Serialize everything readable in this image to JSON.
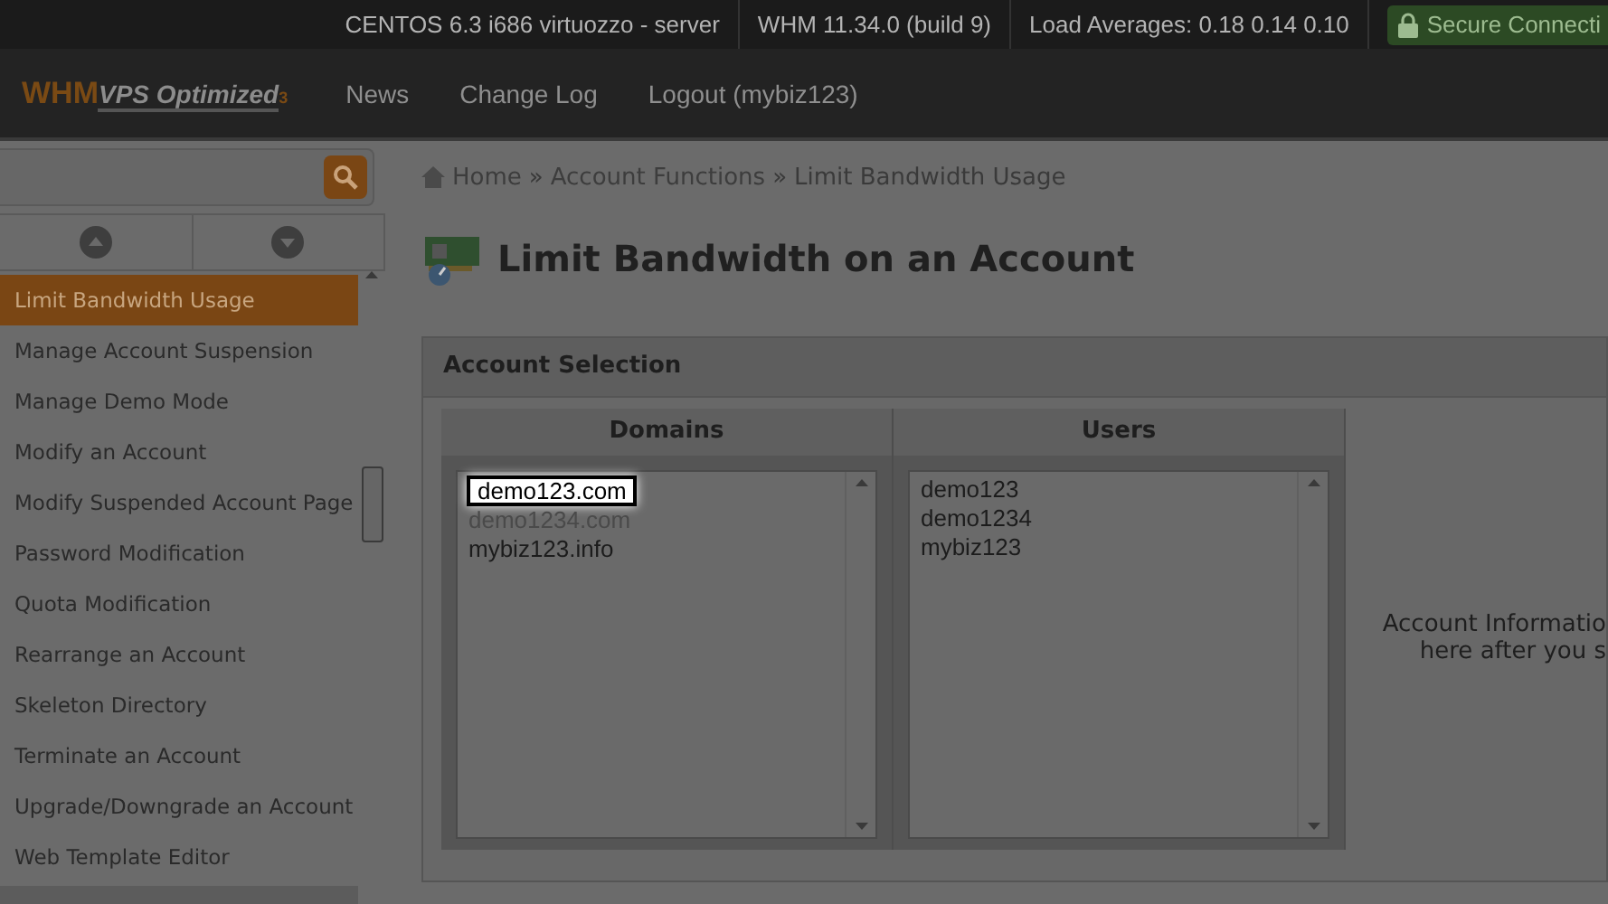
{
  "top_bar": {
    "items": [
      "CENTOS 6.3 i686 virtuozzo - server",
      "WHM 11.34.0 (build 9)",
      "Load Averages: 0.18 0.14 0.10"
    ],
    "secure": "Secure Connecti"
  },
  "nav": {
    "logo_main": "WHM",
    "logo_sub": "VPS Optimized",
    "logo_mark": "3",
    "links": [
      "News",
      "Change Log",
      "Logout (mybiz123)"
    ]
  },
  "sidebar": {
    "items": [
      {
        "label": "Limit Bandwidth Usage",
        "selected": true
      },
      {
        "label": "Manage Account Suspension",
        "selected": false
      },
      {
        "label": "Manage Demo Mode",
        "selected": false
      },
      {
        "label": "Modify an Account",
        "selected": false
      },
      {
        "label": "Modify Suspended Account Page",
        "selected": false
      },
      {
        "label": "Password Modification",
        "selected": false
      },
      {
        "label": "Quota Modification",
        "selected": false
      },
      {
        "label": "Rearrange an Account",
        "selected": false
      },
      {
        "label": "Skeleton Directory",
        "selected": false
      },
      {
        "label": "Terminate an Account",
        "selected": false
      },
      {
        "label": "Upgrade/Downgrade an Account",
        "selected": false
      },
      {
        "label": "Web Template Editor",
        "selected": false
      }
    ]
  },
  "breadcrumb": [
    "Home",
    "Account Functions",
    "Limit Bandwidth Usage"
  ],
  "breadcrumb_separators": [
    "»",
    "»"
  ],
  "page_title": "Limit Bandwidth on an Account",
  "panel": {
    "title": "Account Selection",
    "columns": [
      {
        "heading": "Domains",
        "items": [
          {
            "label": "demo123.com",
            "selected": true
          },
          {
            "label": "demo1234.com",
            "selected": false
          },
          {
            "label": "mybiz123.info",
            "selected": false
          }
        ]
      },
      {
        "heading": "Users",
        "items": [
          {
            "label": "demo123",
            "selected": false
          },
          {
            "label": "demo1234",
            "selected": false
          },
          {
            "label": "mybiz123",
            "selected": false
          }
        ]
      }
    ],
    "info_lines": [
      "Account Informatio",
      "here after you s"
    ]
  }
}
